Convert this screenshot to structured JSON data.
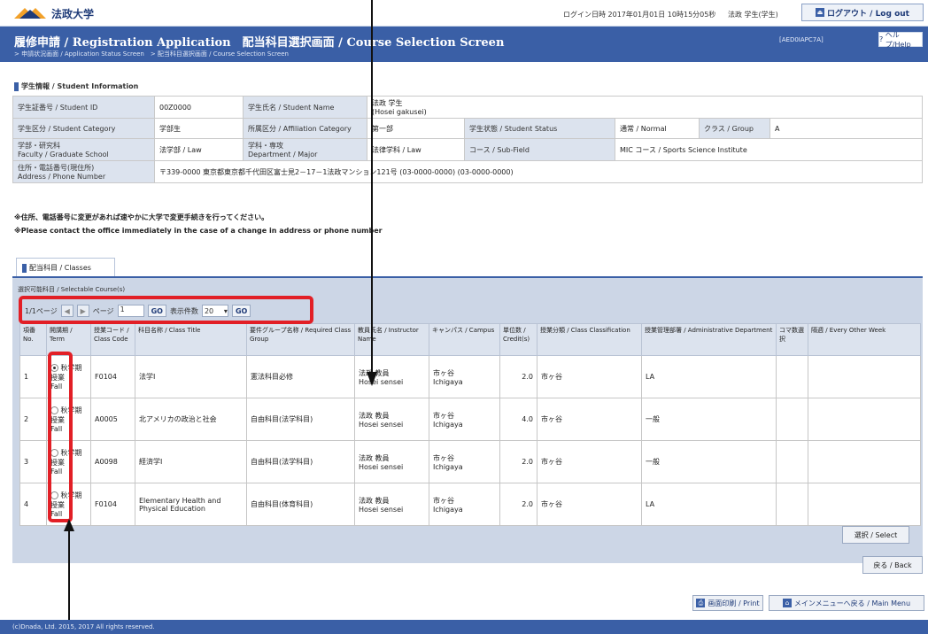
{
  "header": {
    "logo_text": "法政大学",
    "login_info": "ログイン日時 2017年01月01日 10時15分05秒",
    "user_info": "法政 学生(学生)",
    "logout_label": "ログアウト / Log out"
  },
  "titlebar": {
    "title": "履修申請 / Registration Application　配当科目選択画面 / Course Selection Screen",
    "breadcrumb": "> 申請状況画面 / Application Status Screen　> 配当科目選択画面 / Course Selection Screen",
    "screen_id": "[AED0IAPC7A]",
    "help_label": "ヘルプ/Help"
  },
  "student_section": {
    "heading": "学生情報 / Student Information",
    "rows": [
      {
        "c": [
          {
            "label": "学生証番号 / Student ID"
          },
          {
            "value": "00Z0000"
          },
          {
            "label": "学生氏名 / Student Name"
          },
          {
            "value": "法政 学生\n(Hosei gakusei)"
          }
        ]
      },
      {
        "c": [
          {
            "label": "学生区分 / Student Category"
          },
          {
            "value": "学部生"
          },
          {
            "label": "所属区分 / Affiliation Category"
          },
          {
            "value": "第一部"
          },
          {
            "label": "学生状態 / Student Status"
          },
          {
            "value": "通常 / Normal"
          },
          {
            "label": "クラス / Group"
          },
          {
            "value": "A"
          }
        ]
      },
      {
        "c": [
          {
            "label": "学部・研究科\nFaculty / Graduate School"
          },
          {
            "value": "法学部 / Law"
          },
          {
            "label": "学科・専攻\nDepartment / Major"
          },
          {
            "value": "法律学科 / Law"
          },
          {
            "label": "コース / Sub-Field"
          },
          {
            "value": "MIC コース / Sports Science Institute"
          }
        ]
      },
      {
        "c": [
          {
            "label": "住所・電話番号(現住所)\nAddress / Phone Number"
          },
          {
            "value": "〒339-0000 東京都東京都千代田区富士見2－17－1法政マンション121号 (03-0000-0000) (03-0000-0000)"
          }
        ]
      }
    ]
  },
  "notice": {
    "line1": "※住所、電話番号に変更があれば速やかに大学で変更手続きを行ってください。",
    "line2": "※Please contact the office immediately in the case of a change in address or phone number"
  },
  "courses_tab": {
    "label": "配当科目 / Classes",
    "caption": "選択可能科目 / Selectable Course(s)",
    "pager": {
      "first_label": "1/1ページ",
      "prev": "◀",
      "next": "▶",
      "page_label": "ページ",
      "page_value": "1",
      "go_label": "GO",
      "per_page_label": "表示件数",
      "per_page_value": "20",
      "go2_label": "GO"
    }
  },
  "table": {
    "headers": [
      "項番 No.",
      "開講期 / Term",
      "授業コード / Class Code",
      "科目名称 / Class Title",
      "要件グループ名称 / Required Class Group",
      "教員氏名 / Instructor Name",
      "キャンパス / Campus",
      "単位数 / Credit(s)",
      "授業分類 / Class Classification",
      "授業管理部署 / Administrative Department",
      "コマ数選択",
      "隔週 / Every Other Week"
    ],
    "rows": [
      {
        "no": "1",
        "selected": true,
        "term": "秋学期授業\nFall",
        "code": "F0104",
        "title": "法学Ⅰ",
        "group": "憲法科目必修",
        "instructor": "法政 教員\nHosei sensei",
        "campus": "市ヶ谷\nIchigaya",
        "credits": "2.0",
        "class_type": "市ヶ谷",
        "dept": "LA",
        "koma": "",
        "biweekly": ""
      },
      {
        "no": "2",
        "selected": false,
        "term": "秋学期授業\nFall",
        "code": "A0005",
        "title": "北アメリカの政治と社会",
        "group": "自由科目(法学科目)",
        "instructor": "法政 教員\nHosei sensei",
        "campus": "市ヶ谷\nIchigaya",
        "credits": "4.0",
        "class_type": "市ヶ谷",
        "dept": "一般",
        "koma": "",
        "biweekly": ""
      },
      {
        "no": "3",
        "selected": false,
        "term": "秋学期授業\nFall",
        "code": "A0098",
        "title": "経済学Ⅰ",
        "group": "自由科目(法学科目)",
        "instructor": "法政 教員\nHosei sensei",
        "campus": "市ヶ谷\nIchigaya",
        "credits": "2.0",
        "class_type": "市ヶ谷",
        "dept": "一般",
        "koma": "",
        "biweekly": ""
      },
      {
        "no": "4",
        "selected": false,
        "term": "秋学期授業\nFall",
        "code": "F0104",
        "title": "Elementary Health and Physical Education",
        "group": "自由科目(体育科目)",
        "instructor": "法政 教員\nHosei sensei",
        "campus": "市ヶ谷\nIchigaya",
        "credits": "2.0",
        "class_type": "市ヶ谷",
        "dept": "LA",
        "koma": "",
        "biweekly": ""
      }
    ]
  },
  "buttons": {
    "select": "選択 / Select",
    "back": "戻る / Back",
    "print": "画面印刷 / Print",
    "main_menu": "メインメニューへ戻る / Main Menu"
  },
  "footer": {
    "copyright": "(c)Dnada, Ltd. 2015, 2017 All rights reserved."
  },
  "annotation_colors": {
    "highlight": "#e21f26",
    "arrow": "#111111"
  }
}
